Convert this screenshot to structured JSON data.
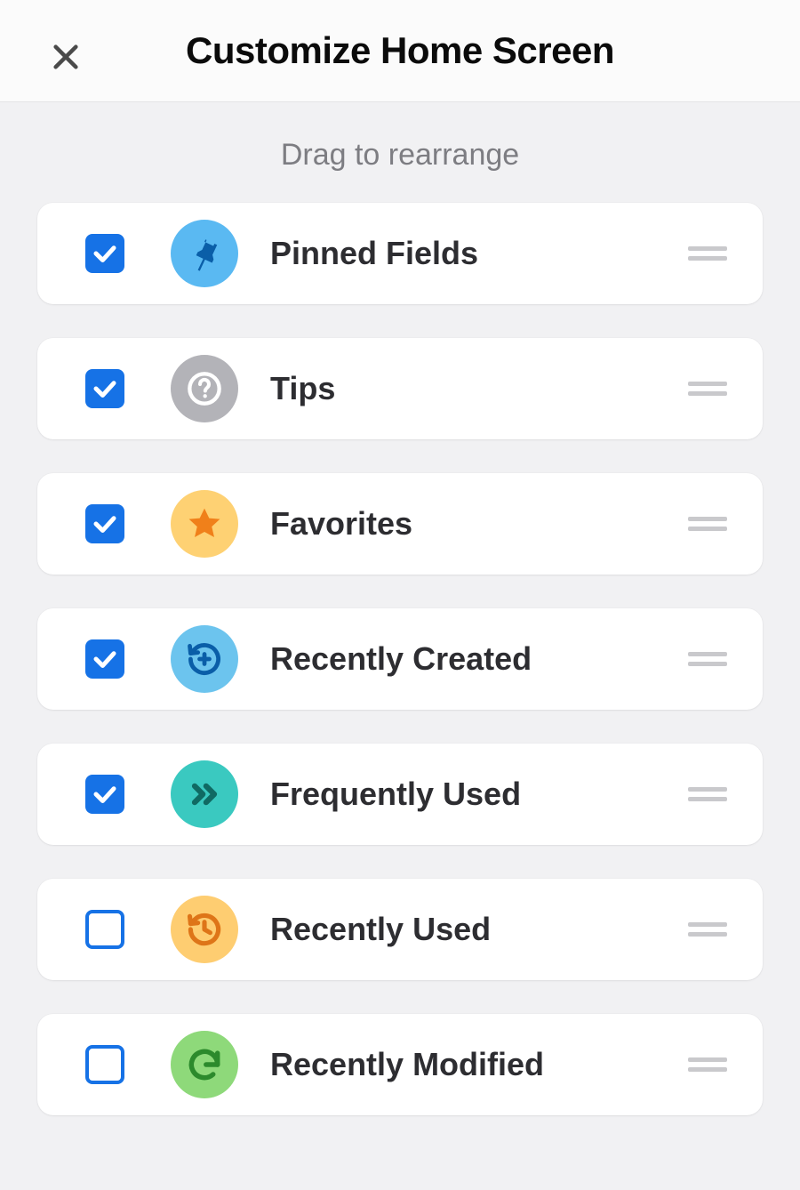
{
  "header": {
    "title": "Customize Home Screen"
  },
  "subheader": "Drag to rearrange",
  "items": [
    {
      "label": "Pinned Fields",
      "checked": true,
      "icon": "pin",
      "badge": "badge-pin"
    },
    {
      "label": "Tips",
      "checked": true,
      "icon": "question",
      "badge": "badge-tips"
    },
    {
      "label": "Favorites",
      "checked": true,
      "icon": "star",
      "badge": "badge-fav"
    },
    {
      "label": "Recently Created",
      "checked": true,
      "icon": "history-plus",
      "badge": "badge-created"
    },
    {
      "label": "Frequently Used",
      "checked": true,
      "icon": "chevrons",
      "badge": "badge-freq"
    },
    {
      "label": "Recently Used",
      "checked": false,
      "icon": "history",
      "badge": "badge-used"
    },
    {
      "label": "Recently Modified",
      "checked": false,
      "icon": "refresh",
      "badge": "badge-mod"
    }
  ]
}
